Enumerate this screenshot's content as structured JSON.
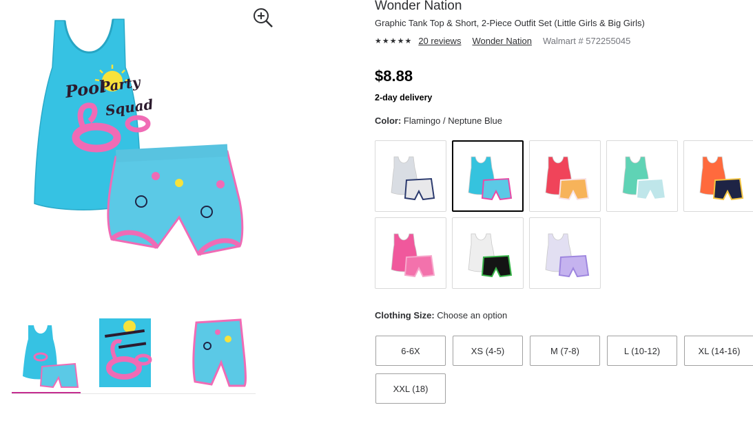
{
  "gallery": {
    "main_image": "tank-top-and-shorts-photo",
    "zoom_icon": "zoom-in-icon",
    "thumbnails": [
      {
        "name": "outfit-set-thumbnail",
        "active": true
      },
      {
        "name": "tank-graphic-thumbnail",
        "active": false
      },
      {
        "name": "shorts-thumbnail",
        "active": false
      }
    ],
    "graphic_text": [
      "Pool",
      "Party",
      "Squad"
    ]
  },
  "product": {
    "brand": "Wonder Nation",
    "title": "Graphic Tank Top & Short, 2-Piece Outfit Set (Little Girls & Big Girls)",
    "stars": "★★★★★",
    "reviews_link": "20 reviews",
    "brand_link": "Wonder Nation",
    "item_number": "Walmart # 572255045",
    "price": "$8.88",
    "delivery": "2-day delivery",
    "color_label": "Color:",
    "color_value": "Flamingo / Neptune Blue"
  },
  "swatches": [
    {
      "top": "#d9dde3",
      "shorts": "#e8e8ea",
      "trim": "#2b3a6e",
      "selected": false
    },
    {
      "top": "#35c3de",
      "shorts": "#5bc9e6",
      "trim": "#e94aa6",
      "selected": true
    },
    {
      "top": "#f0445a",
      "shorts": "#f7b35a",
      "trim": "#f8e2e6",
      "selected": false
    },
    {
      "top": "#5fd3b5",
      "shorts": "#bfe6ea",
      "trim": "#ffffff",
      "selected": false
    },
    {
      "top": "#ff6a3d",
      "shorts": "#1e2445",
      "trim": "#f4c542",
      "selected": false
    },
    {
      "top": "#f0589c",
      "shorts": "#f372ac",
      "trim": "#f7a8cc",
      "selected": false
    },
    {
      "top": "#eeeeee",
      "shorts": "#141414",
      "trim": "#39b54a",
      "selected": false
    },
    {
      "top": "#e2dff2",
      "shorts": "#c5b3ef",
      "trim": "#9e86df",
      "selected": false
    }
  ],
  "size": {
    "label": "Clothing Size:",
    "value": "Choose an option",
    "options": [
      "6-6X",
      "XS (4-5)",
      "M (7-8)",
      "L (10-12)",
      "XL (14-16)",
      "XXL (18)"
    ]
  },
  "colors": {
    "accent_pink": "#c42b8f",
    "tank_blue": "#36c2e3",
    "flamingo_pink": "#f06bb5",
    "text_dark": "#2e2f32",
    "text_muted": "#74767c"
  }
}
